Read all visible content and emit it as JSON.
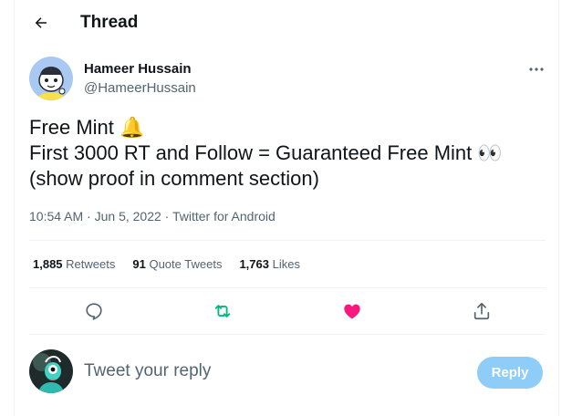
{
  "header": {
    "title": "Thread",
    "back_icon": "arrow-left-icon"
  },
  "tweet": {
    "author": {
      "name": "Hameer Hussain",
      "handle": "@HameerHussain",
      "avatar": "cartoon-avatar"
    },
    "text_lines": [
      "Free Mint 🔔",
      "First 3000 RT and Follow  = Guaranteed Free Mint 👀",
      "(show proof in comment section)"
    ],
    "time": "10:54 AM",
    "date": "Jun 5, 2022",
    "sep": " · ",
    "source": "Twitter for Android",
    "stats": {
      "retweets_count": "1,885",
      "retweets_label": "Retweets",
      "quotes_count": "91",
      "quotes_label": "Quote Tweets",
      "likes_count": "1,763",
      "likes_label": "Likes"
    },
    "actions": {
      "reply_icon": "speech-bubble-icon",
      "retweet_icon": "retweet-icon",
      "like_icon": "heart-icon",
      "share_icon": "share-icon",
      "retweet_color": "#00ba7c",
      "like_color": "#f91880"
    }
  },
  "composer": {
    "placeholder": "Tweet your reply",
    "button_label": "Reply",
    "avatar": "user-avatar"
  },
  "colors": {
    "accent": "#1d9bf0",
    "reply_button_disabled": "#8ecdf8",
    "muted_text": "#536471"
  }
}
